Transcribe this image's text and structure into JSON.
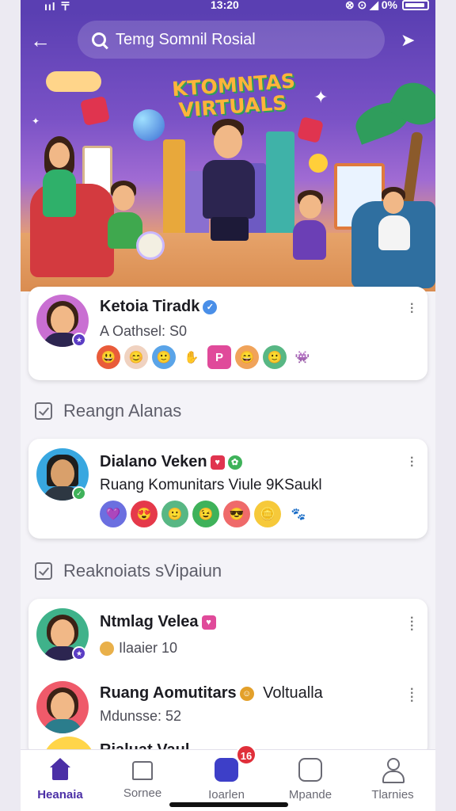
{
  "status_bar": {
    "left": "ııl 〒",
    "time": "13:20",
    "right": "⊗ ⊙ ◢ 0%"
  },
  "header": {
    "search_text": "Temg Somnil Rosial"
  },
  "hero": {
    "title_line1": "KTOMNTAS",
    "title_line2": "VIRTUALS"
  },
  "cards": [
    {
      "name": "Ketoia Tiradk",
      "subtitle": "A Oathsel: S0",
      "emojis": [
        "😃",
        "😊",
        "🙂",
        "✋",
        "P",
        "😄",
        "🙂",
        "👾"
      ]
    },
    {
      "name": "Dialano Veken",
      "subtitle": "Ruang Komunitars Viule 9KSaukl",
      "emojis": [
        "💜",
        "😍",
        "🙂",
        "😉",
        "😎",
        "🪙",
        "🐾"
      ]
    },
    {
      "name": "Ntmlag Velea",
      "subtitle": "Ilaaier 10",
      "name2": "Ruang Aomutitars",
      "name2_suffix": "Voltualla",
      "subtitle2": "Mdunsse: 52",
      "name3": "Rialuat Vaul"
    }
  ],
  "sections": {
    "first": "Reangn Alanas",
    "second": "Reaknoiats sVipaiun"
  },
  "tabbar": {
    "tabs": [
      {
        "label": "Heanaia"
      },
      {
        "label": "Sornee"
      },
      {
        "label": "Ioarlen"
      },
      {
        "label": "Mpande"
      },
      {
        "label": "Tlarnies"
      }
    ],
    "badge": "16"
  },
  "colors": {
    "accent": "#4b2fa6",
    "hero_top": "#5a3fb2",
    "badge": "#e02f3a"
  }
}
